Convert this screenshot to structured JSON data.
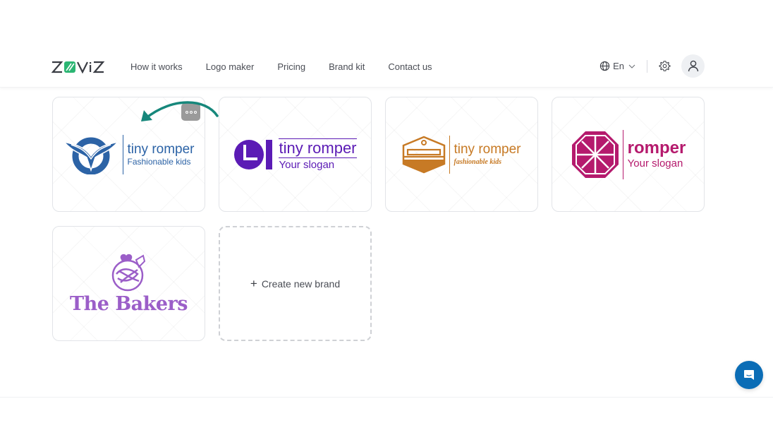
{
  "header": {
    "brand": "ZOVIZ",
    "nav": [
      {
        "label": "How it works"
      },
      {
        "label": "Logo maker"
      },
      {
        "label": "Pricing"
      },
      {
        "label": "Brand kit"
      },
      {
        "label": "Contact us"
      }
    ],
    "language": "En",
    "icons": {
      "language": "globe-icon",
      "settings": "gear-icon",
      "profile": "user-icon"
    }
  },
  "brands": [
    {
      "name": "tiny romper",
      "slogan": "Fashionable kids",
      "color": "#2c63a6",
      "icon": "wing-circle-icon"
    },
    {
      "name": "tiny romper",
      "slogan": "Your slogan",
      "color": "#5b1bb5",
      "icon": "clock-letter-icon"
    },
    {
      "name": "tiny romper",
      "slogan": "fashionable kids",
      "color": "#c77a25",
      "icon": "bed-hexagon-icon"
    },
    {
      "name": "romper",
      "slogan": "Your slogan",
      "color": "#b51a6d",
      "icon": "octagon-wheel-icon"
    },
    {
      "name": "The Bakers",
      "slogan": "",
      "color": "#9b5ec8",
      "icon": "chef-whisk-icon"
    }
  ],
  "create_card": {
    "plus": "+",
    "label": "Create new brand"
  },
  "more_menu": {
    "icon": "more-icon"
  },
  "chat": {
    "icon": "chat-icon",
    "color": "#0b6db6"
  },
  "annotation": {
    "arrow_color": "#16877b"
  }
}
